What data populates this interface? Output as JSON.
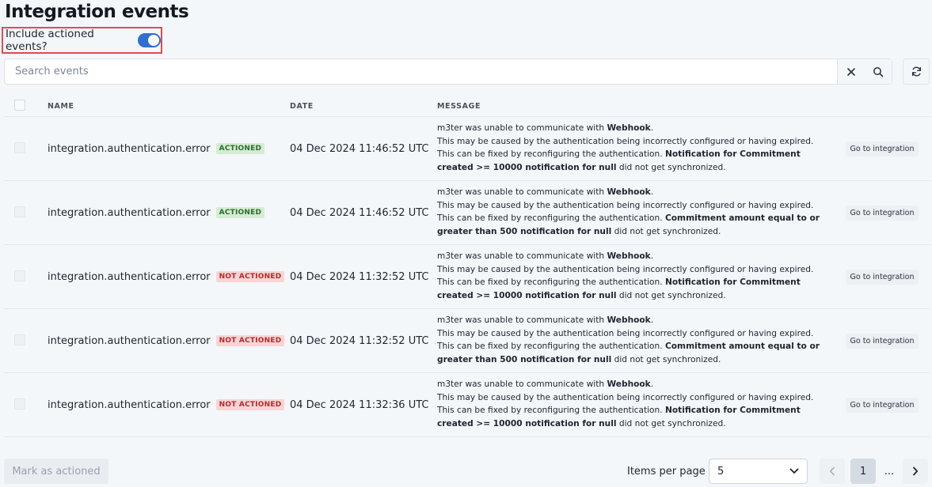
{
  "page": {
    "title": "Integration events"
  },
  "filter": {
    "include_actioned_label": "Include actioned events?",
    "include_actioned": true
  },
  "search": {
    "placeholder": "Search events",
    "value": ""
  },
  "table": {
    "columns": {
      "name": "NAME",
      "date": "DATE",
      "message": "MESSAGE"
    },
    "rows": [
      {
        "name": "integration.authentication.error",
        "status": "ACTIONED",
        "status_type": "actioned",
        "date": "04 Dec 2024 11:46:52 UTC",
        "msg_intro": "m3ter was unable to communicate with ",
        "msg_target": "Webhook",
        "msg_line2": "This may be caused by the authentication being incorrectly configured or having expired.",
        "msg_line3": "This can be fixed by reconfiguring the authentication. ",
        "msg_bold_a": "Notification for Commitment",
        "msg_bold_b": "created >= 10000 notification for null",
        "msg_tail": " did not get synchronized.",
        "action": "Go to integration"
      },
      {
        "name": "integration.authentication.error",
        "status": "ACTIONED",
        "status_type": "actioned",
        "date": "04 Dec 2024 11:46:52 UTC",
        "msg_intro": "m3ter was unable to communicate with ",
        "msg_target": "Webhook",
        "msg_line2": "This may be caused by the authentication being incorrectly configured or having expired.",
        "msg_line3": "This can be fixed by reconfiguring the authentication. ",
        "msg_bold_a": "Commitment amount equal to or",
        "msg_bold_b": "greater than 500 notification for null",
        "msg_tail": " did not get synchronized.",
        "action": "Go to integration"
      },
      {
        "name": "integration.authentication.error",
        "status": "NOT ACTIONED",
        "status_type": "not-actioned",
        "date": "04 Dec 2024 11:32:52 UTC",
        "msg_intro": "m3ter was unable to communicate with ",
        "msg_target": "Webhook",
        "msg_line2": "This may be caused by the authentication being incorrectly configured or having expired.",
        "msg_line3": "This can be fixed by reconfiguring the authentication. ",
        "msg_bold_a": "Notification for Commitment",
        "msg_bold_b": "created >= 10000 notification for null",
        "msg_tail": " did not get synchronized.",
        "action": "Go to integration"
      },
      {
        "name": "integration.authentication.error",
        "status": "NOT ACTIONED",
        "status_type": "not-actioned",
        "date": "04 Dec 2024 11:32:52 UTC",
        "msg_intro": "m3ter was unable to communicate with ",
        "msg_target": "Webhook",
        "msg_line2": "This may be caused by the authentication being incorrectly configured or having expired.",
        "msg_line3": "This can be fixed by reconfiguring the authentication. ",
        "msg_bold_a": "Commitment amount equal to or",
        "msg_bold_b": "greater than 500 notification for null",
        "msg_tail": " did not get synchronized.",
        "action": "Go to integration"
      },
      {
        "name": "integration.authentication.error",
        "status": "NOT ACTIONED",
        "status_type": "not-actioned",
        "date": "04 Dec 2024 11:32:36 UTC",
        "msg_intro": "m3ter was unable to communicate with ",
        "msg_target": "Webhook",
        "msg_line2": "This may be caused by the authentication being incorrectly configured or having expired.",
        "msg_line3": "This can be fixed by reconfiguring the authentication. ",
        "msg_bold_a": "Notification for Commitment",
        "msg_bold_b": "created >= 10000 notification for null",
        "msg_tail": " did not get synchronized.",
        "action": "Go to integration"
      }
    ]
  },
  "footer": {
    "mark_as_actioned": "Mark as actioned",
    "items_per_page_label": "Items per page",
    "items_per_page_value": "5",
    "current_page": "1",
    "ellipsis": "..."
  },
  "colors": {
    "accent": "#2f6fd1",
    "highlight_border": "#e34b4b",
    "actioned_bg": "#d4ecd3",
    "not_actioned_bg": "#f8d4d4"
  },
  "icons": [
    "clear-icon",
    "search-icon",
    "refresh-icon",
    "chevron-down-icon",
    "chevron-left-icon",
    "chevron-right-icon"
  ]
}
